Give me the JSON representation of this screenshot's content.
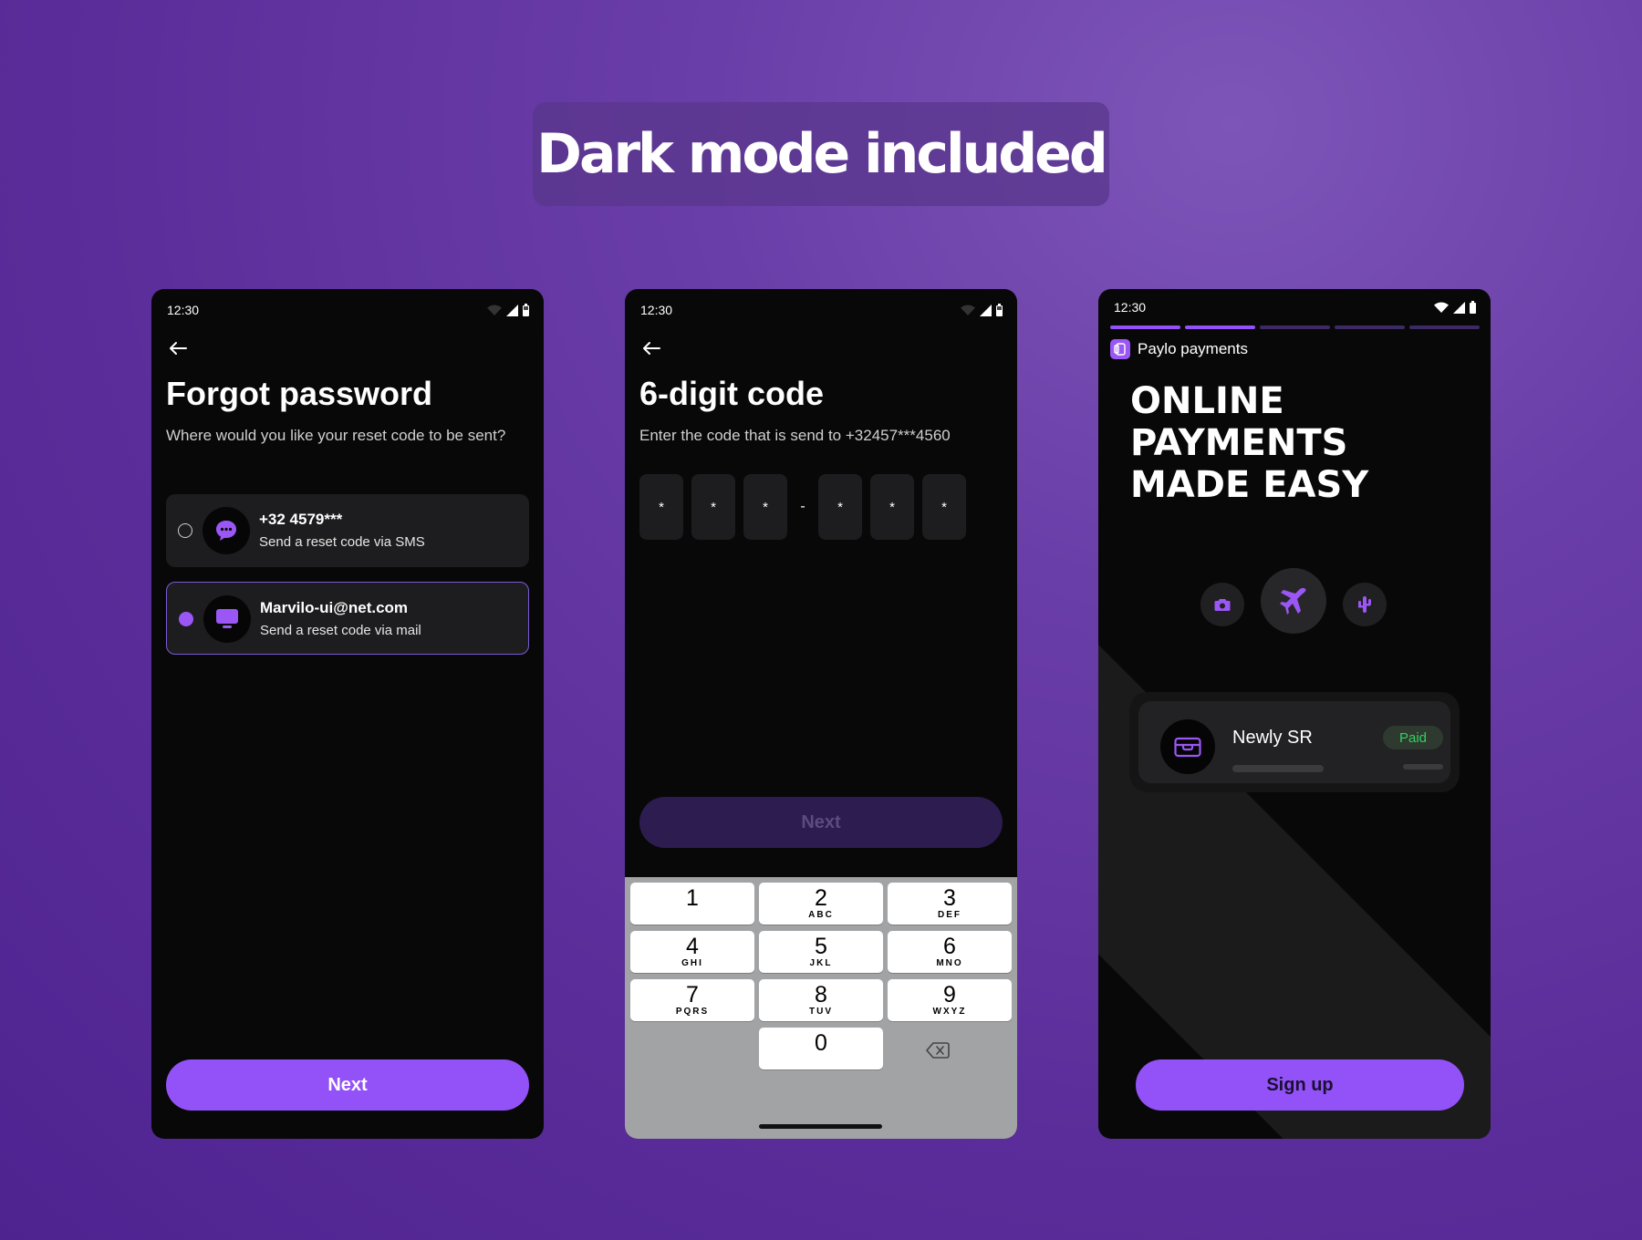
{
  "banner": {
    "title": "Dark mode included"
  },
  "colors": {
    "accent": "#9352f7",
    "phone_bg": "#080808",
    "paid_green": "#35d05e"
  },
  "status_bar": {
    "time": "12:30",
    "icons": [
      "wifi-icon",
      "signal-icon",
      "battery-icon"
    ]
  },
  "forgot_password": {
    "title": "Forgot password",
    "subtitle": "Where would you like your reset code to be sent?",
    "options": [
      {
        "title": "+32 4579***",
        "subtitle": "Send a reset code via SMS",
        "icon": "chat-icon",
        "selected": false
      },
      {
        "title": "Marvilo-ui@net.com",
        "subtitle": "Send a reset code via mail",
        "icon": "monitor-icon",
        "selected": true
      }
    ],
    "next_label": "Next"
  },
  "six_digit": {
    "title": "6-digit code",
    "subtitle": "Enter the code that is send to +32457***4560",
    "code": [
      "*",
      "*",
      "*",
      "*",
      "*",
      "*"
    ],
    "separator": "-",
    "next_label": "Next",
    "keypad": [
      {
        "num": "1",
        "letters": ""
      },
      {
        "num": "2",
        "letters": "ABC"
      },
      {
        "num": "3",
        "letters": "DEF"
      },
      {
        "num": "4",
        "letters": "GHI"
      },
      {
        "num": "5",
        "letters": "JKL"
      },
      {
        "num": "6",
        "letters": "MNO"
      },
      {
        "num": "7",
        "letters": "PQRS"
      },
      {
        "num": "8",
        "letters": "TUV"
      },
      {
        "num": "9",
        "letters": "WXYZ"
      },
      {
        "num": "0",
        "letters": ""
      }
    ]
  },
  "onboarding": {
    "progress": {
      "steps": 5,
      "completed": 2
    },
    "brand_name": "Paylo payments",
    "headline_lines": [
      "ONLINE",
      "PAYMENTS",
      "MADE EASY"
    ],
    "feature_icons": [
      "camera-icon",
      "airplane-icon",
      "cactus-icon"
    ],
    "payment": {
      "name": "Newly SR",
      "status": "Paid",
      "icon": "wallet-icon"
    },
    "signup_label": "Sign up"
  }
}
